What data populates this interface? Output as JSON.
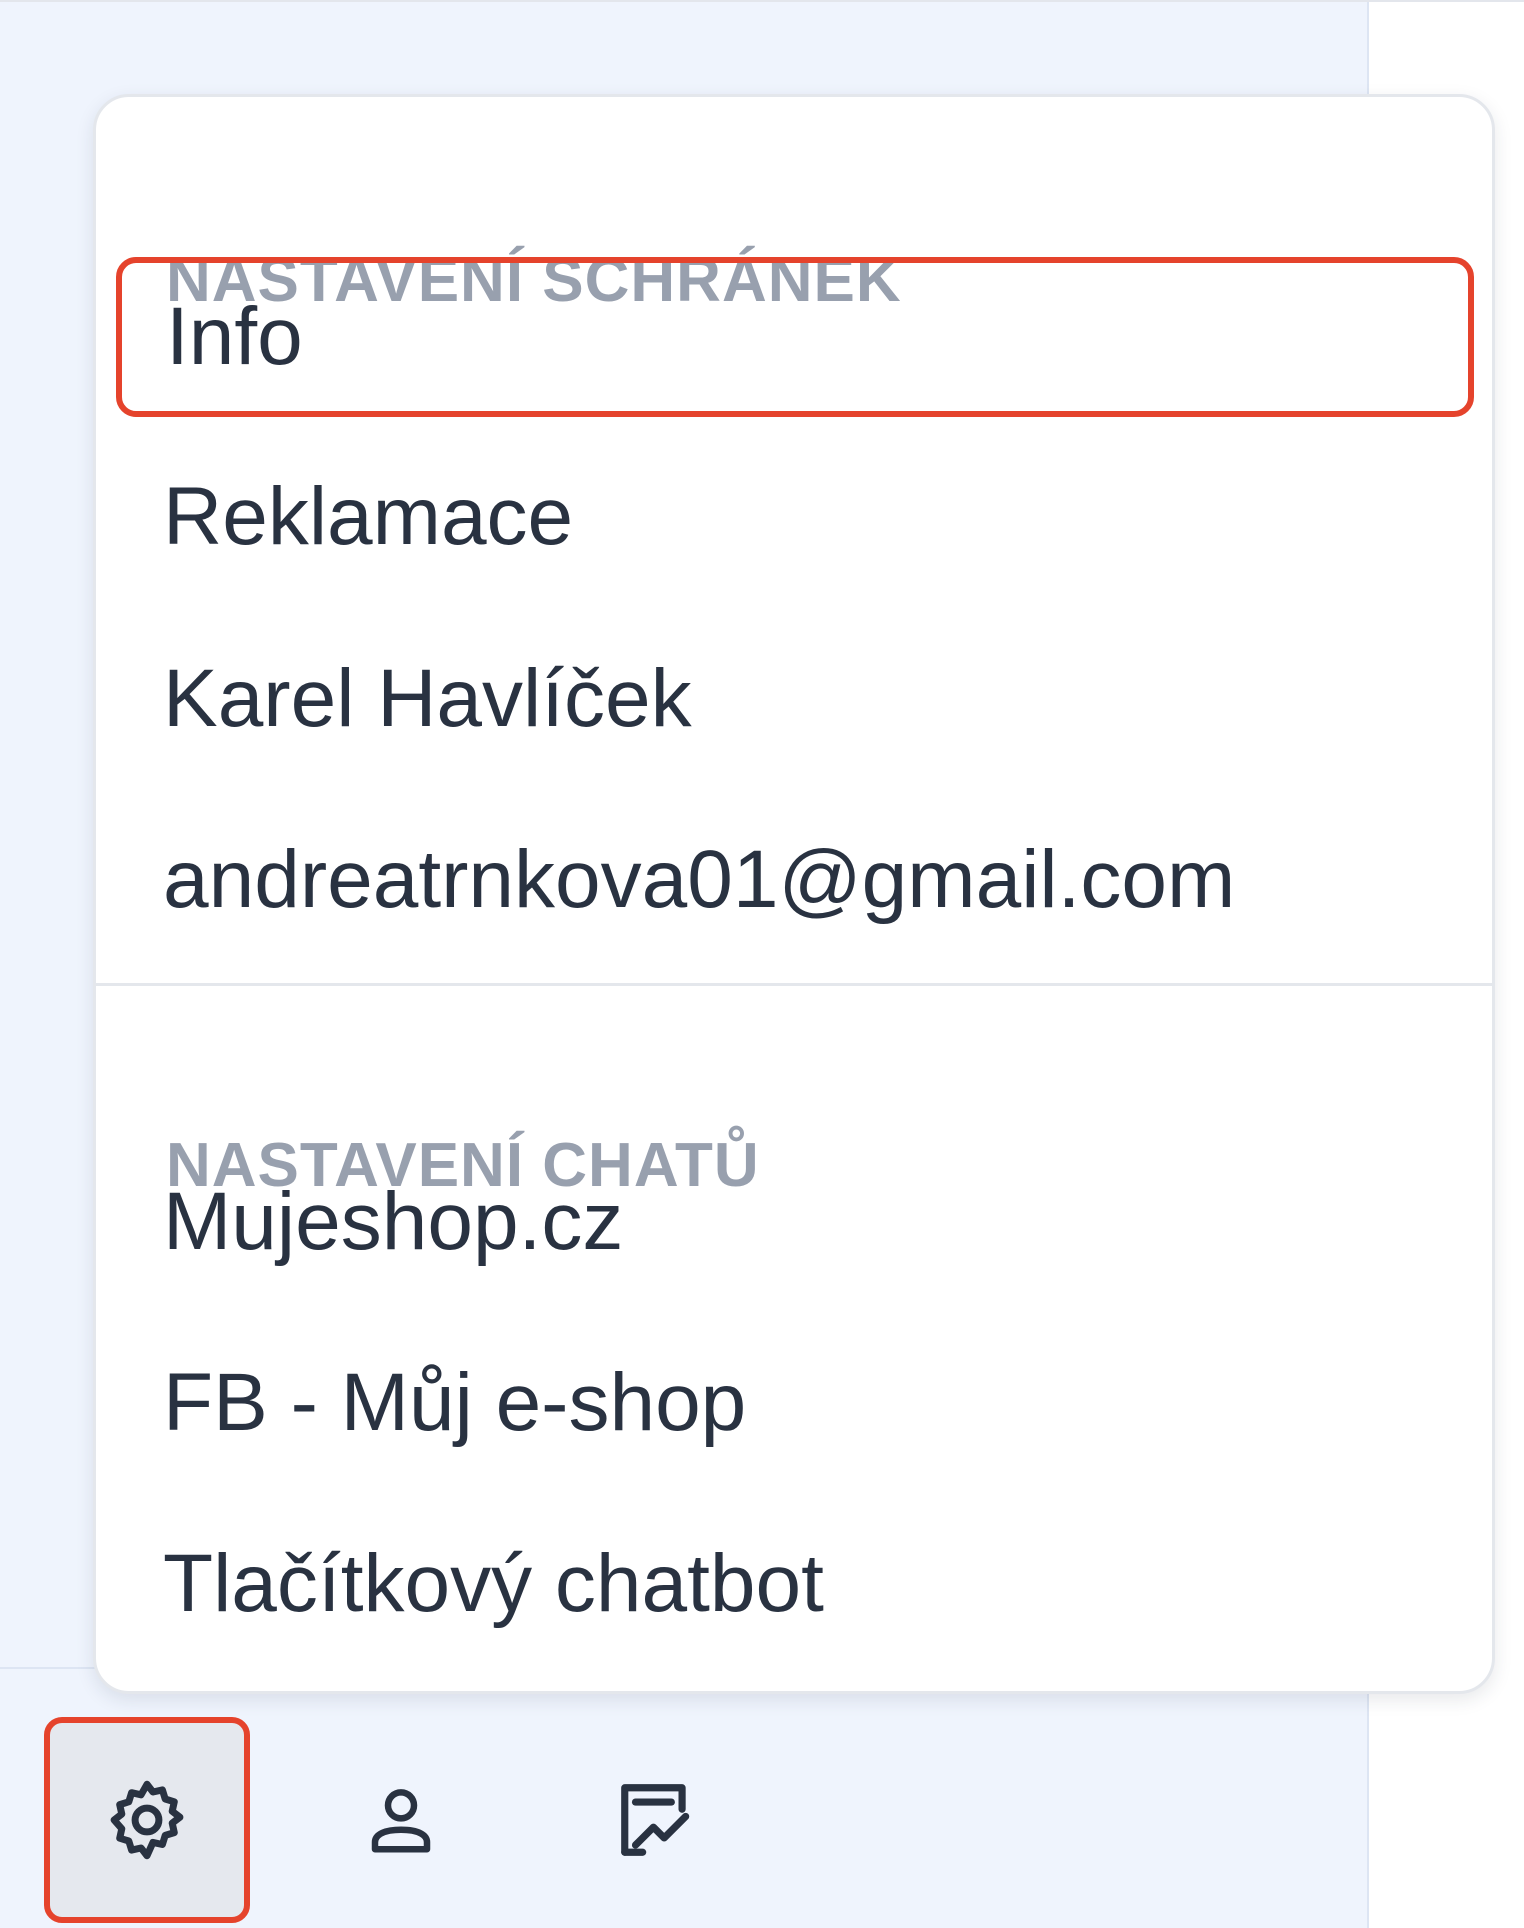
{
  "settings_menu": {
    "mailbox_section": {
      "title": "NASTAVENÍ SCHRÁNEK",
      "items": [
        {
          "label": "Info",
          "highlighted": true
        },
        {
          "label": "Reklamace"
        },
        {
          "label": "Karel Havlíček"
        },
        {
          "label": "andreatrnkova01@gmail.com"
        }
      ]
    },
    "chat_section": {
      "title": "NASTAVENÍ CHATŮ",
      "items": [
        {
          "label": "Mujeshop.cz"
        },
        {
          "label": "FB - Můj e-shop"
        },
        {
          "label": "Tlačítkový chatbot"
        }
      ]
    }
  },
  "toolbar": {
    "buttons": [
      {
        "icon": "gear-icon",
        "active": true
      },
      {
        "icon": "user-icon"
      },
      {
        "icon": "report-chart-icon"
      }
    ]
  },
  "colors": {
    "highlight_border": "#e5432c",
    "sidebar_background": "#eff4fd",
    "section_header_text": "#98a0ae",
    "menu_item_text": "#293241"
  }
}
